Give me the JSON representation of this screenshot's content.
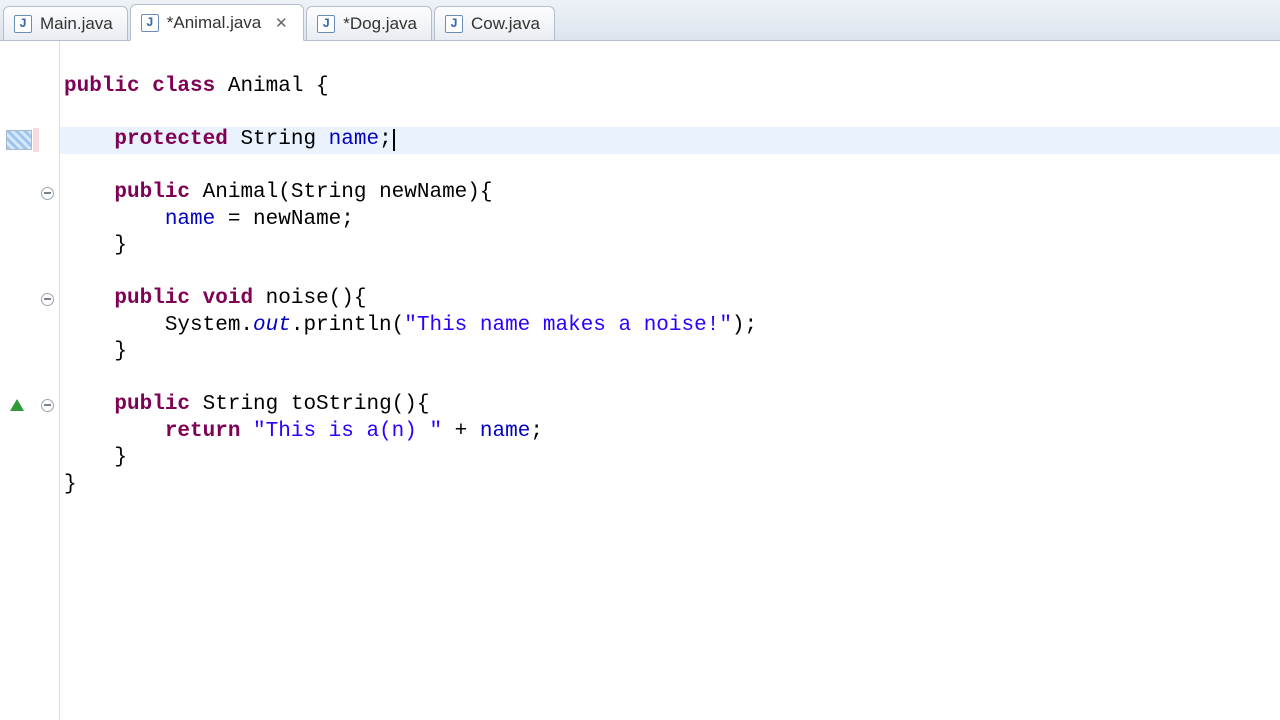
{
  "tabs": [
    {
      "label": "Main.java",
      "dirty": false,
      "active": false
    },
    {
      "label": "*Animal.java",
      "dirty": true,
      "active": true
    },
    {
      "label": "*Dog.java",
      "dirty": true,
      "active": false
    },
    {
      "label": "Cow.java",
      "dirty": false,
      "active": false
    }
  ],
  "highlighted_line_index": 2,
  "gutter": {
    "change_marker_line": 2,
    "fold_lines": [
      4,
      8,
      12
    ],
    "override_line": 12
  },
  "code": {
    "lines": [
      {
        "tokens": [
          {
            "t": "public ",
            "c": "kw"
          },
          {
            "t": "class ",
            "c": "kw"
          },
          {
            "t": "Animal {",
            "c": "plain"
          }
        ]
      },
      {
        "tokens": []
      },
      {
        "tokens": [
          {
            "t": "    ",
            "c": "plain"
          },
          {
            "t": "protected ",
            "c": "kw"
          },
          {
            "t": "String ",
            "c": "plain"
          },
          {
            "t": "name",
            "c": "field"
          },
          {
            "t": ";",
            "c": "plain"
          }
        ],
        "cursor_after": true
      },
      {
        "tokens": []
      },
      {
        "tokens": [
          {
            "t": "    ",
            "c": "plain"
          },
          {
            "t": "public ",
            "c": "kw"
          },
          {
            "t": "Animal(String newName){",
            "c": "plain"
          }
        ]
      },
      {
        "tokens": [
          {
            "t": "        ",
            "c": "plain"
          },
          {
            "t": "name",
            "c": "field"
          },
          {
            "t": " = newName;",
            "c": "plain"
          }
        ]
      },
      {
        "tokens": [
          {
            "t": "    }",
            "c": "plain"
          }
        ]
      },
      {
        "tokens": []
      },
      {
        "tokens": [
          {
            "t": "    ",
            "c": "plain"
          },
          {
            "t": "public ",
            "c": "kw"
          },
          {
            "t": "void ",
            "c": "kw"
          },
          {
            "t": "noise(){",
            "c": "plain"
          }
        ]
      },
      {
        "tokens": [
          {
            "t": "        System.",
            "c": "plain"
          },
          {
            "t": "out",
            "c": "field-it"
          },
          {
            "t": ".println(",
            "c": "plain"
          },
          {
            "t": "\"This name makes a noise!\"",
            "c": "str"
          },
          {
            "t": ");",
            "c": "plain"
          }
        ]
      },
      {
        "tokens": [
          {
            "t": "    }",
            "c": "plain"
          }
        ]
      },
      {
        "tokens": []
      },
      {
        "tokens": [
          {
            "t": "    ",
            "c": "plain"
          },
          {
            "t": "public ",
            "c": "kw"
          },
          {
            "t": "String toString(){",
            "c": "plain"
          }
        ]
      },
      {
        "tokens": [
          {
            "t": "        ",
            "c": "plain"
          },
          {
            "t": "return ",
            "c": "kw"
          },
          {
            "t": "\"This is a(n) \"",
            "c": "str"
          },
          {
            "t": " + ",
            "c": "plain"
          },
          {
            "t": "name",
            "c": "field"
          },
          {
            "t": ";",
            "c": "plain"
          }
        ]
      },
      {
        "tokens": [
          {
            "t": "    }",
            "c": "plain"
          }
        ]
      },
      {
        "tokens": [
          {
            "t": "}",
            "c": "plain"
          }
        ]
      }
    ]
  }
}
